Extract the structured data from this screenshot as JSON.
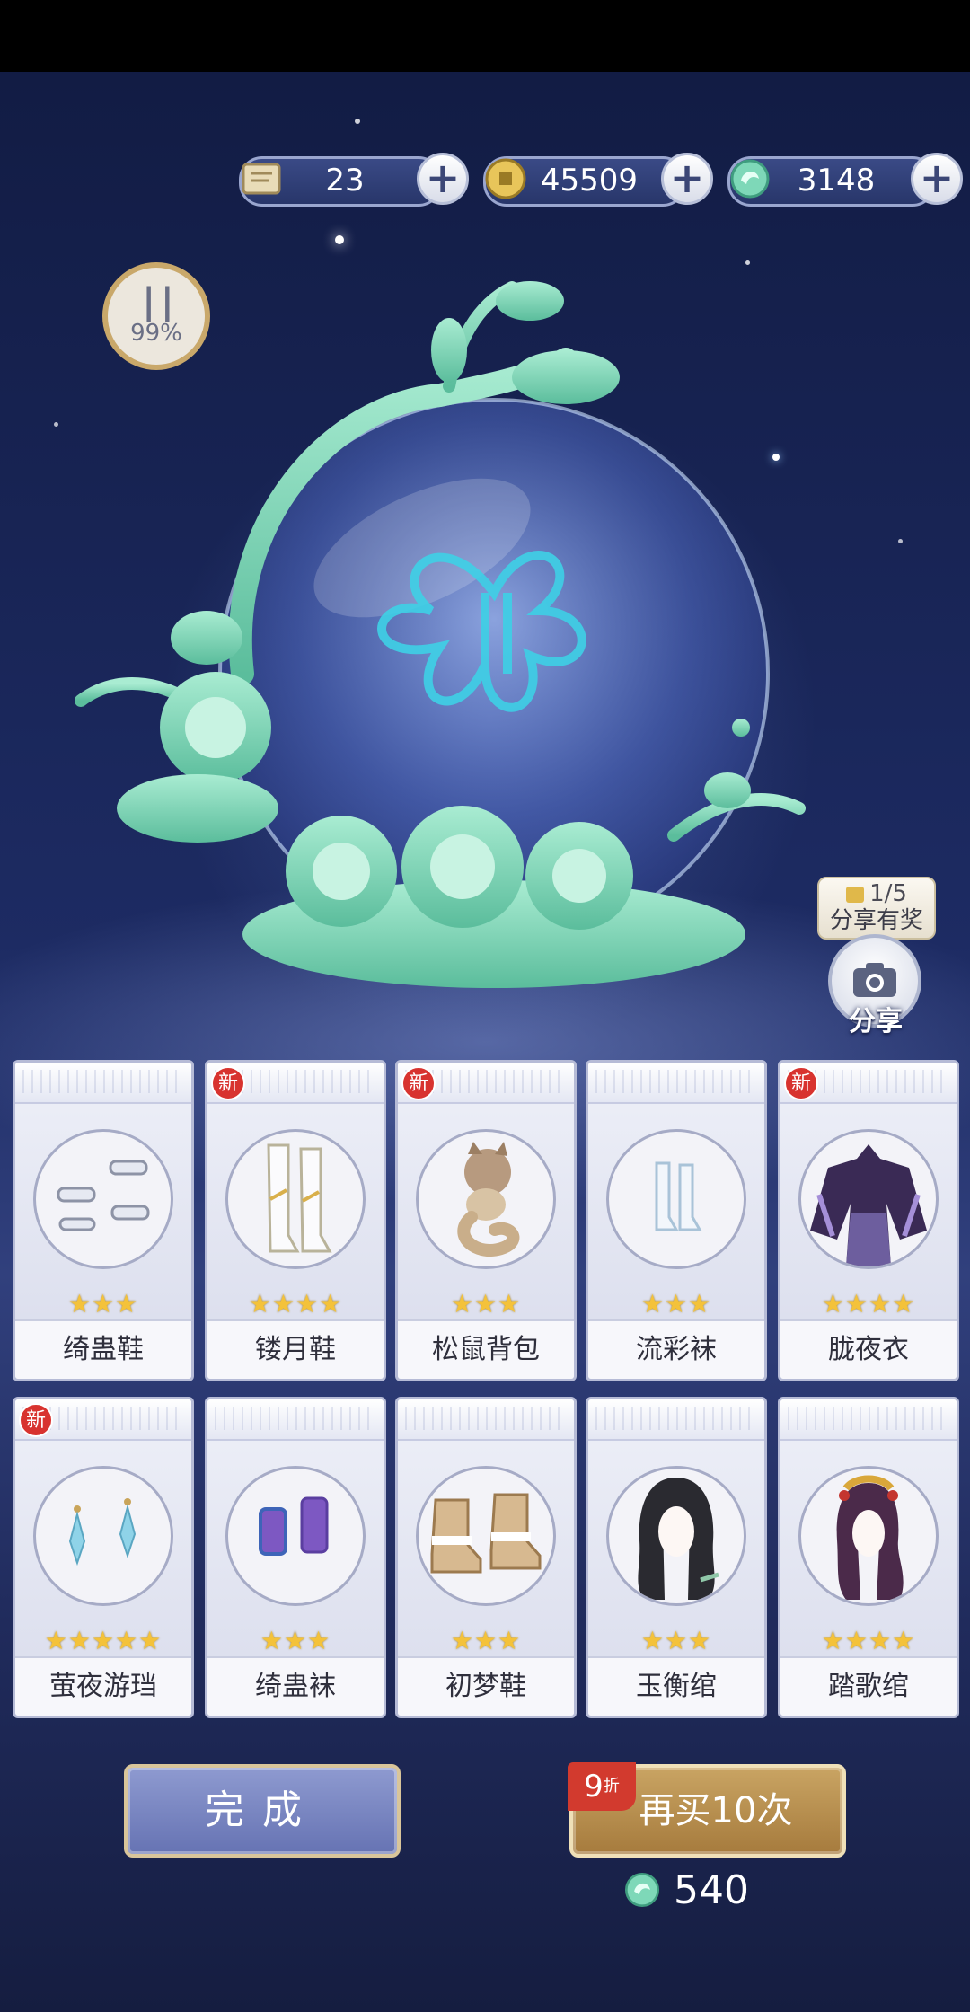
{
  "currencies": [
    {
      "icon": "scroll-ticket-icon",
      "value": "23"
    },
    {
      "icon": "gold-coin-icon",
      "value": "45509"
    },
    {
      "icon": "jade-dragon-icon",
      "value": "3148"
    }
  ],
  "pause": {
    "progress": "99%"
  },
  "share": {
    "count": "1/5",
    "reward_label": "分享有奖",
    "label": "分享"
  },
  "items": [
    {
      "name": "绮蛊鞋",
      "stars": "★★★",
      "is_new": false
    },
    {
      "name": "镂月鞋",
      "stars": "★★★★",
      "is_new": true
    },
    {
      "name": "松鼠背包",
      "stars": "★★★",
      "is_new": true
    },
    {
      "name": "流彩袜",
      "stars": "★★★",
      "is_new": false
    },
    {
      "name": "胧夜衣",
      "stars": "★★★★",
      "is_new": true
    },
    {
      "name": "萤夜游珰",
      "stars": "★★★★★",
      "is_new": true
    },
    {
      "name": "绮蛊袜",
      "stars": "★★★",
      "is_new": false
    },
    {
      "name": "初梦鞋",
      "stars": "★★★",
      "is_new": false
    },
    {
      "name": "玉衡绾",
      "stars": "★★★",
      "is_new": false
    },
    {
      "name": "踏歌绾",
      "stars": "★★★★",
      "is_new": false
    }
  ],
  "new_badge": "新",
  "buttons": {
    "done_label": "完成",
    "again_label": "再买10次",
    "discount_num": "9",
    "discount_unit": "折"
  },
  "cost": "540",
  "colors": {
    "jade": "#7ed8b8",
    "gold_star": "#f4c23a",
    "new_red": "#d8332f"
  }
}
